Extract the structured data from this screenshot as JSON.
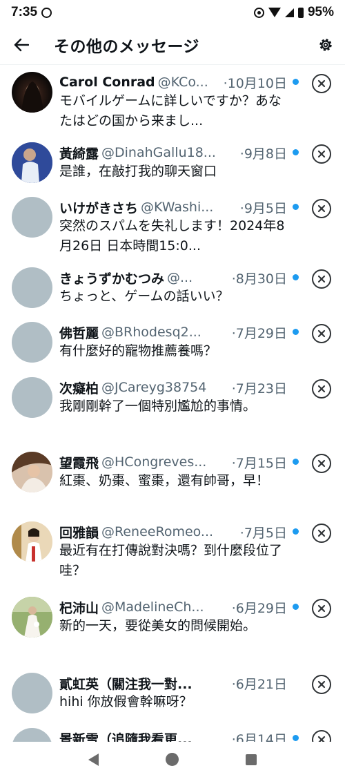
{
  "status": {
    "time": "7:35",
    "battery": "95%"
  },
  "header": {
    "title": "その他のメッセージ"
  },
  "colors": {
    "accent": "#1d9bf0",
    "avatar_placeholder": "#b0bec5"
  },
  "messages": [
    {
      "name": "Carol Conrad",
      "handle": "@KCo...",
      "date": "·10月10日",
      "text": "モバイルゲームに詳しいですか？あなたはどの国から来まし...",
      "avatar": "photo"
    },
    {
      "name": "黃綺露",
      "handle": "@DinahGallu18...",
      "date": "·9月8日",
      "text": "是誰，在敲打我的聊天窗口",
      "avatar": "photo"
    },
    {
      "name": "いけがきさち",
      "handle": "@KWashi...",
      "date": "·9月5日",
      "text": "突然のスパムを失礼します！2024年8月26日 日本時間15:0...",
      "avatar": "default"
    },
    {
      "name": "きょうずかむつみ",
      "handle": "@...",
      "date": "·8月30日",
      "text": "ちょっと、ゲームの話いい？",
      "avatar": "default"
    },
    {
      "name": "佛哲麗",
      "handle": "@BRhodesq2...",
      "date": "·7月29日",
      "text": "有什麼好的寵物推薦養嗎？",
      "avatar": "default"
    },
    {
      "name": "次癡柏",
      "handle": "@JCareyg38754",
      "date": "·7月23日",
      "text": "我剛剛幹了一個特別尷尬的事情。",
      "avatar": "default"
    },
    {
      "name": "望霞飛",
      "handle": "@HCongreves...",
      "date": "·7月15日",
      "text": "紅棗、奶棗、蜜棗，還有帥哥，早！",
      "avatar": "photo"
    },
    {
      "name": "回雅韻",
      "handle": "@ReneeRomeo...",
      "date": "·7月5日",
      "text": "最近有在打傳說對決嗎？到什麼段位了哇？",
      "avatar": "photo"
    },
    {
      "name": "杞沛山",
      "handle": "@MadelineCh...",
      "date": "·6月29日",
      "text": "新的一天，要從美女的問候開始。",
      "avatar": "photo"
    },
    {
      "name": "貳虹英（關注我一對...",
      "handle": "",
      "date": "·6月21日",
      "text": "hihi 你放假會幹嘛呀？",
      "avatar": "default"
    },
    {
      "name": "景新雪（追隨我看更...",
      "handle": "",
      "date": "·6月14日",
      "text": "",
      "avatar": "default"
    }
  ]
}
